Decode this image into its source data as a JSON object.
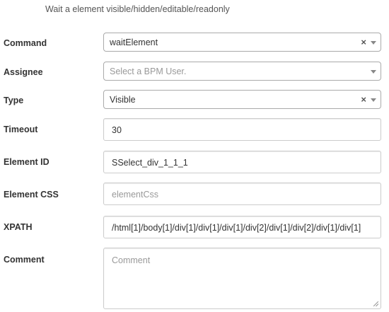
{
  "description": "Wait a element visible/hidden/editable/readonly",
  "fields": {
    "command": {
      "label": "Command",
      "value": "waitElement",
      "clear": "×"
    },
    "assignee": {
      "label": "Assignee",
      "placeholder": "Select a BPM User."
    },
    "type": {
      "label": "Type",
      "value": "Visible",
      "clear": "×"
    },
    "timeout": {
      "label": "Timeout",
      "value": "30"
    },
    "element_id": {
      "label": "Element ID",
      "value": "SSelect_div_1_1_1"
    },
    "element_css": {
      "label": "Element CSS",
      "placeholder": "elementCss"
    },
    "xpath": {
      "label": "XPATH",
      "value": "/html[1]/body[1]/div[1]/div[1]/div[1]/div[2]/div[1]/div[2]/div[1]/div[1]"
    },
    "comment": {
      "label": "Comment",
      "placeholder": "Comment"
    }
  },
  "icons": {
    "dropdown": "chevron-down-icon",
    "clear": "clear-icon",
    "resize": "resize-handle-icon"
  }
}
